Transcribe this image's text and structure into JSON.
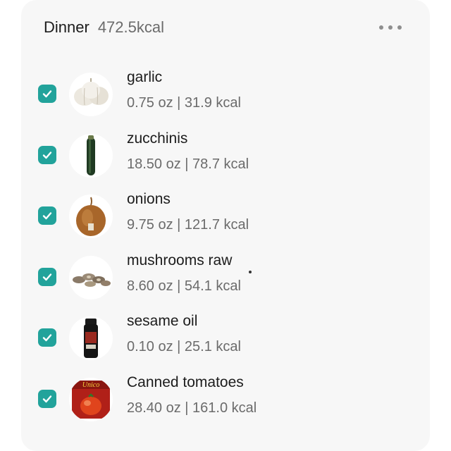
{
  "meal": {
    "title": "Dinner",
    "kcal": "472.5kcal"
  },
  "menu": {
    "icon": "more-horizontal-icon"
  },
  "items": [
    {
      "name": "garlic",
      "detail": "0.75 oz | 31.9 kcal",
      "checked": true,
      "image": "garlic-image"
    },
    {
      "name": "zucchinis",
      "detail": "18.50 oz | 78.7 kcal",
      "checked": true,
      "image": "zucchini-image"
    },
    {
      "name": "onions",
      "detail": "9.75 oz | 121.7 kcal",
      "checked": true,
      "image": "onion-image"
    },
    {
      "name": "mushrooms raw",
      "detail": "8.60 oz | 54.1 kcal",
      "checked": true,
      "image": "mushrooms-image"
    },
    {
      "name": "sesame oil",
      "detail": "0.10 oz | 25.1 kcal",
      "checked": true,
      "image": "sesame-oil-bottle-image"
    },
    {
      "name": "Canned tomatoes",
      "detail": "28.40 oz | 161.0 kcal",
      "checked": true,
      "image": "canned-tomatoes-image",
      "logo_text": "Unico"
    }
  ],
  "colors": {
    "accent": "#22a39b",
    "card": "#f7f7f7",
    "primary_text": "#1c1c1c",
    "secondary_text": "#6b6b6b"
  }
}
